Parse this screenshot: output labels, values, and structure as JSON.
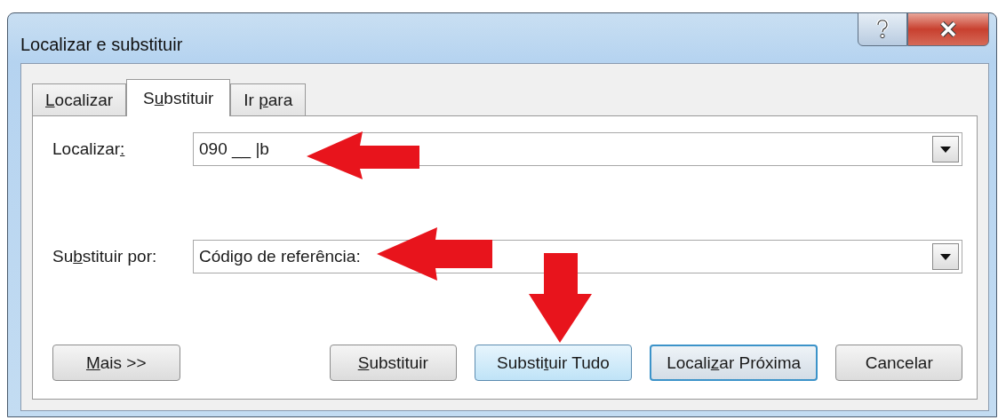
{
  "window": {
    "title": "Localizar e substituir"
  },
  "tabs": [
    {
      "label": {
        "key": "L",
        "after": "ocalizar"
      },
      "selected": false
    },
    {
      "label": {
        "before": "S",
        "key": "u",
        "after": "bstituir"
      },
      "selected": true
    },
    {
      "label": {
        "before": "Ir ",
        "key": "p",
        "after": "ara"
      },
      "selected": false
    }
  ],
  "fields": [
    {
      "label": {
        "before": "Localizar",
        "key": ":"
      },
      "value": "090 __ |b"
    },
    {
      "label": {
        "before": "Su",
        "key": "b",
        "after": "stituir por:"
      },
      "value": "Código de referência:"
    }
  ],
  "buttons": [
    {
      "label": {
        "key": "M",
        "after": "ais >>"
      },
      "kind": "normal"
    },
    {
      "label": {
        "key": "S",
        "after": "ubstituir"
      },
      "kind": "normal"
    },
    {
      "label": {
        "before": "Substi",
        "key": "t",
        "after": "uir Tudo"
      },
      "kind": "hover"
    },
    {
      "label": {
        "before": "Locali",
        "key": "z",
        "after": "ar Próxima"
      },
      "kind": "default"
    },
    {
      "label": {
        "before": "Cancelar"
      },
      "kind": "normal"
    }
  ]
}
